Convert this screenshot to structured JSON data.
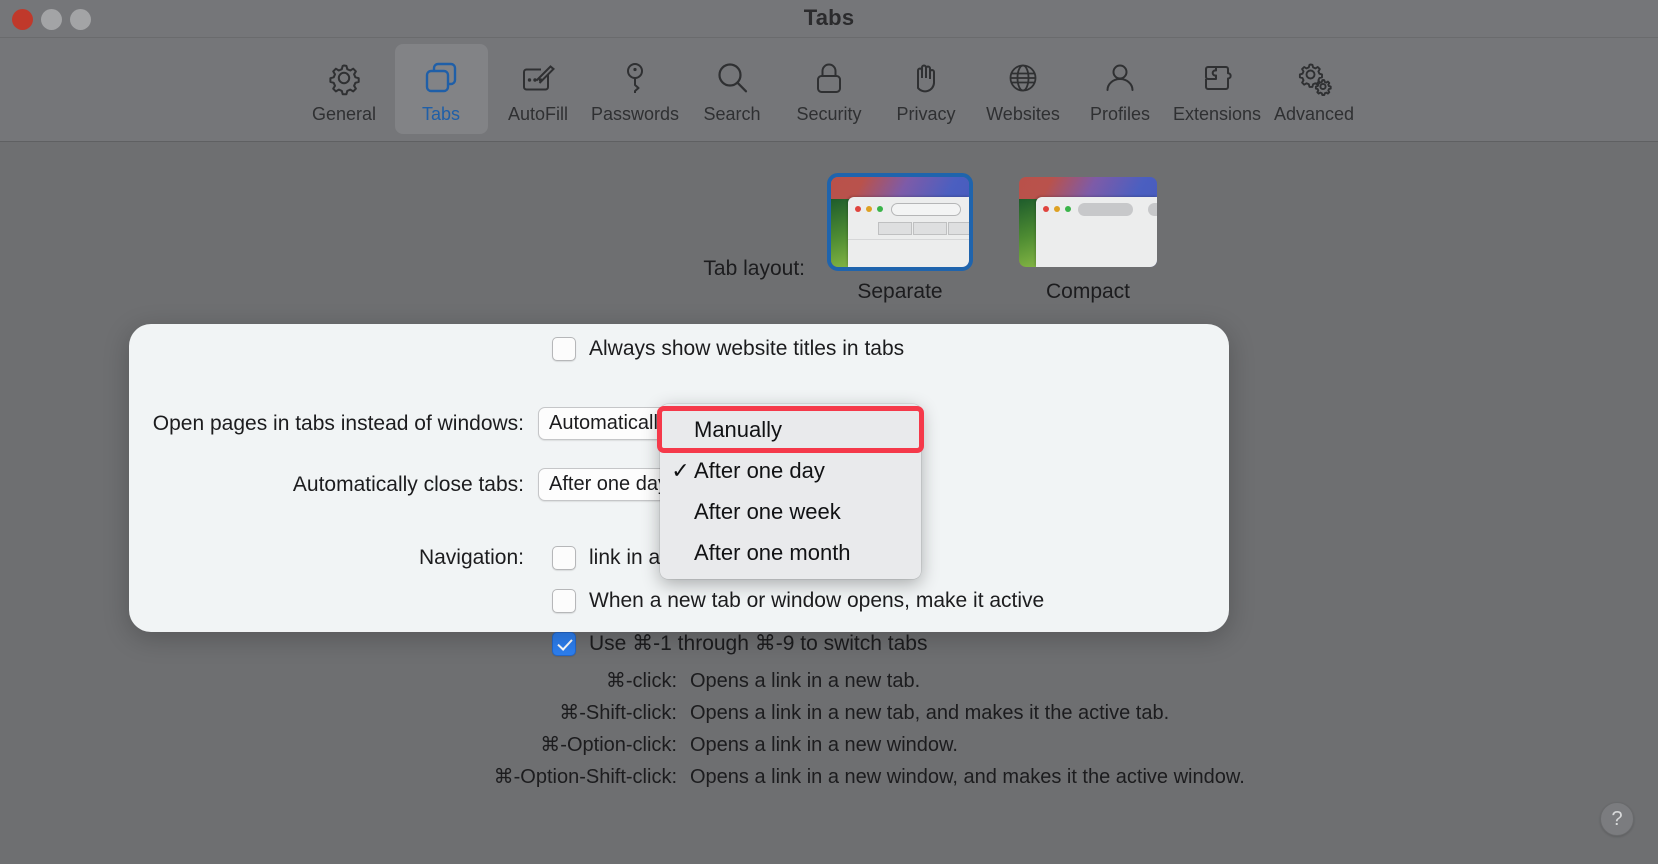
{
  "window": {
    "title": "Tabs",
    "traffic_lights": [
      "close",
      "minimize",
      "maximize"
    ]
  },
  "toolbar": {
    "items": [
      {
        "label": "General",
        "icon": "gear-icon",
        "selected": false
      },
      {
        "label": "Tabs",
        "icon": "tabs-icon",
        "selected": true
      },
      {
        "label": "AutoFill",
        "icon": "autofill-icon",
        "selected": false
      },
      {
        "label": "Passwords",
        "icon": "key-icon",
        "selected": false
      },
      {
        "label": "Search",
        "icon": "magnifier-icon",
        "selected": false
      },
      {
        "label": "Security",
        "icon": "lock-icon",
        "selected": false
      },
      {
        "label": "Privacy",
        "icon": "hand-icon",
        "selected": false
      },
      {
        "label": "Websites",
        "icon": "globe-icon",
        "selected": false
      },
      {
        "label": "Profiles",
        "icon": "person-icon",
        "selected": false
      },
      {
        "label": "Extensions",
        "icon": "puzzle-icon",
        "selected": false
      },
      {
        "label": "Advanced",
        "icon": "gears-icon",
        "selected": false
      }
    ]
  },
  "main": {
    "tab_layout": {
      "label": "Tab layout:",
      "options": [
        {
          "caption": "Separate",
          "selected": true
        },
        {
          "caption": "Compact",
          "selected": false
        }
      ]
    },
    "always_show_titles": {
      "label": "Always show website titles in tabs",
      "checked": false
    },
    "open_pages_in_tabs": {
      "label": "Open pages in tabs instead of windows:",
      "value": "Automatically"
    },
    "auto_close_tabs": {
      "label": "Automatically close tabs:",
      "value": "After one day"
    },
    "navigation": {
      "label": "Navigation:",
      "checkbox_label_tail": "link in a new tab",
      "checked": false
    },
    "make_active": {
      "label": "When a new tab or window opens, make it active",
      "checked": false
    },
    "switch_tabs": {
      "label": "Use ⌘-1 through ⌘-9 to switch tabs",
      "checked": true
    }
  },
  "dropdown": {
    "open": true,
    "highlighted_index": 0,
    "selected_index": 1,
    "items": [
      {
        "label": "Manually",
        "checked": false,
        "highlighted": true
      },
      {
        "label": "After one day",
        "checked": true,
        "highlighted": false
      },
      {
        "label": "After one week",
        "checked": false,
        "highlighted": false
      },
      {
        "label": "After one month",
        "checked": false,
        "highlighted": false
      }
    ],
    "check_glyph": "✓",
    "highlight_color": "#f5394a"
  },
  "shortcuts": {
    "rows": [
      {
        "key": "⌘-click:",
        "desc": "Opens a link in a new tab."
      },
      {
        "key": "⌘-Shift-click:",
        "desc": "Opens a link in a new tab, and makes it the active tab."
      },
      {
        "key": "⌘-Option-click:",
        "desc": "Opens a link in a new window."
      },
      {
        "key": "⌘-Option-Shift-click:",
        "desc": "Opens a link in a new window, and makes it the active window."
      }
    ]
  },
  "help": {
    "label": "?"
  },
  "colors": {
    "accent": "#2d7ff0",
    "selected_border": "#1f64ad",
    "highlight": "#f5394a",
    "window_bg": "#6e6f71",
    "toolbar_bg": "#757679",
    "sheet_bg": "#f1f4f5",
    "menu_bg": "#e9eaec"
  }
}
